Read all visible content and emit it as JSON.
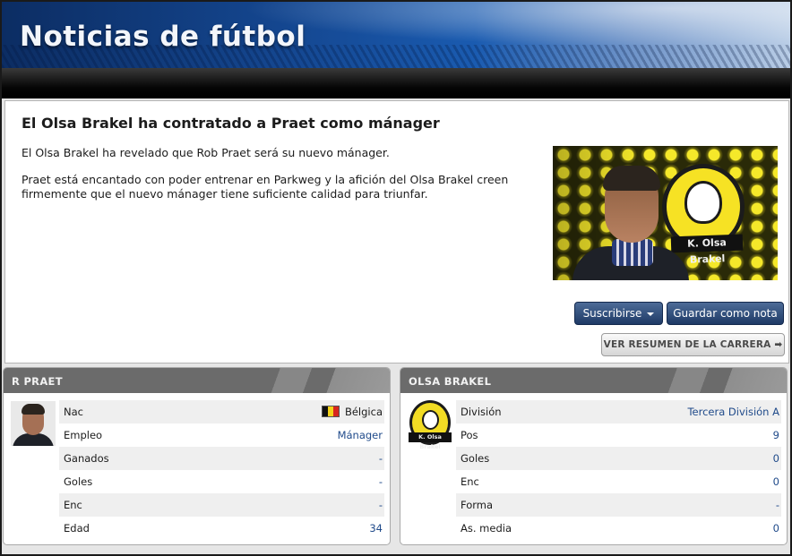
{
  "header": {
    "title": "Noticias de fútbol"
  },
  "article": {
    "title": "El Olsa Brakel ha contratado a Praet como mánager",
    "paragraphs": [
      "El Olsa Brakel ha revelado que Rob Praet será su nuevo mánager.",
      "Praet está encantado con poder entrenar en Parkweg y la afición del Olsa Brakel creen firmemente que el nuevo mánager tiene suficiente calidad para triunfar."
    ],
    "photo_badge_text": "K. Olsa Brakel"
  },
  "buttons": {
    "subscribe": "Suscribirse",
    "save_note": "Guardar como nota",
    "career_summary": "VER RESUMEN DE LA CARRERA ➡"
  },
  "colors": {
    "header_blue": "#14468f",
    "button_blue": "#1e3a66",
    "link_blue": "#1f4a8a",
    "club_yellow": "#f2dc24"
  },
  "person_panel": {
    "title": "R PRAET",
    "rows": [
      {
        "label": "Nac",
        "value": "Bélgica",
        "icon": "belgium-flag-icon"
      },
      {
        "label": "Empleo",
        "value": "Mánager"
      },
      {
        "label": "Ganados",
        "value": "-"
      },
      {
        "label": "Goles",
        "value": "-"
      },
      {
        "label": "Enc",
        "value": "-"
      },
      {
        "label": "Edad",
        "value": "34"
      }
    ]
  },
  "club_panel": {
    "title": "OLSA BRAKEL",
    "badge_text": "K. Olsa Brakel",
    "rows": [
      {
        "label": "División",
        "value": "Tercera División A"
      },
      {
        "label": "Pos",
        "value": "9"
      },
      {
        "label": "Goles",
        "value": "0"
      },
      {
        "label": "Enc",
        "value": "0"
      },
      {
        "label": "Forma",
        "value": "-"
      },
      {
        "label": "As. media",
        "value": "0"
      }
    ]
  }
}
